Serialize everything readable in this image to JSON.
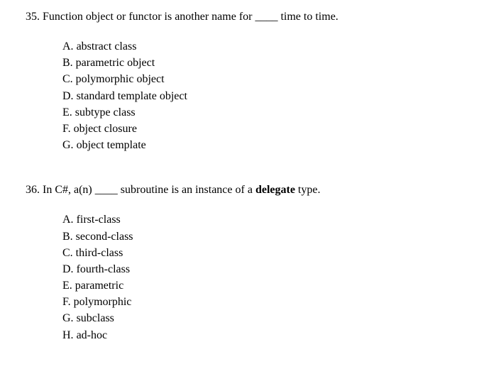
{
  "questions": [
    {
      "number": "35.",
      "text_before": "Function object or functor is another name for ",
      "blank": "____",
      "text_after": " time to time.",
      "options": [
        {
          "letter": "A.",
          "text": "abstract class"
        },
        {
          "letter": "B.",
          "text": "parametric object"
        },
        {
          "letter": "C.",
          "text": "polymorphic object"
        },
        {
          "letter": "D.",
          "text": "standard template object"
        },
        {
          "letter": "E.",
          "text": "subtype class"
        },
        {
          "letter": "F.",
          "text": "object closure"
        },
        {
          "letter": "G.",
          "text": "object template"
        }
      ]
    },
    {
      "number": "36.",
      "text_before": "In C#, a(n) ",
      "blank": "____",
      "text_mid": " subroutine is an instance of a ",
      "bold_word": "delegate",
      "text_after": " type.",
      "options": [
        {
          "letter": "A.",
          "text": "first-class"
        },
        {
          "letter": "B.",
          "text": "second-class"
        },
        {
          "letter": "C.",
          "text": "third-class"
        },
        {
          "letter": "D.",
          "text": "fourth-class"
        },
        {
          "letter": "E.",
          "text": "parametric"
        },
        {
          "letter": "F.",
          "text": "polymorphic"
        },
        {
          "letter": "G.",
          "text": "subclass"
        },
        {
          "letter": "H.",
          "text": "ad-hoc"
        }
      ]
    }
  ]
}
